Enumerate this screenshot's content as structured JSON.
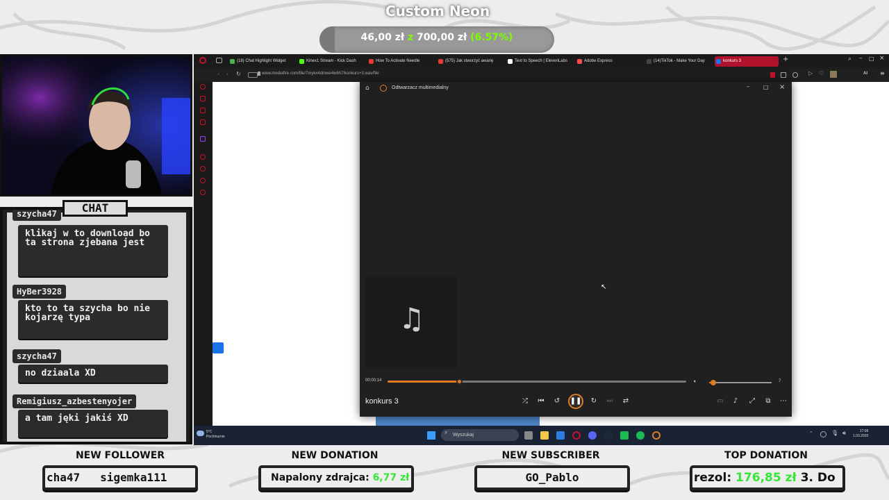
{
  "goal": {
    "title": "Custom Neon",
    "current": "46,00 zł",
    "separator": "z",
    "target": "700,00 zł",
    "percent": "(6.57%)",
    "progress": 0.0657
  },
  "chat": {
    "title": "CHAT",
    "messages": [
      {
        "user": "szycha47",
        "text": "klikaj w to download bo ta strona zjebana jest"
      },
      {
        "user": "HyBer3928",
        "text": "kto to ta szycha bo nie kojarzę typa"
      },
      {
        "user": "szycha47",
        "text": "no dziaala XD"
      },
      {
        "user": "Remigiusz_azbestenyojer",
        "text": "a tam jęki jakiś XD"
      }
    ]
  },
  "browser": {
    "tabs": [
      {
        "label": "(18) Chat Highlight Widget",
        "color": "#4caf50"
      },
      {
        "label": "Kinex1 Stream - Kick Dash",
        "color": "#53fc18"
      },
      {
        "label": "How To Activate Needle",
        "color": "#e53935"
      },
      {
        "label": "(575) Jak stworzyć awarię",
        "color": "#e53935"
      },
      {
        "label": "Text to Speech | ElevenLabs",
        "color": "#ffffff"
      },
      {
        "label": "Adobe Express",
        "color": "#ff4c4c"
      },
      {
        "label": "(14)TikTok - Make Your Day",
        "color": "#111111"
      },
      {
        "label": "konkurs 3",
        "color": "#1a73e8"
      }
    ],
    "url": "www.mediafire.com/file/7mykx4dmwe4w6h7/konkurs+3.wav/file"
  },
  "player": {
    "window_title": "Odtwarzacz multimedialny",
    "time_elapsed": "00:00:14",
    "progress": 0.24,
    "volume": 7,
    "volume_fraction": 0.07,
    "track": "konkurs 3",
    "icons": [
      "shuffle-icon",
      "previous-icon",
      "rewind-10-icon",
      "pause-icon",
      "forward-30-icon",
      "next-icon",
      "repeat-off-icon"
    ]
  },
  "taskbar": {
    "temperature": "5°C",
    "weather": "Pochmurnie",
    "search_placeholder": "Wyszukaj",
    "time": "17:08",
    "date": "1.03.2026"
  },
  "alerts": {
    "follower": {
      "label": "NEW FOLLOWER",
      "value": "cha47   sigemka111"
    },
    "donation": {
      "label": "NEW DONATION",
      "name": "Napalony zdrajca:",
      "amount": "6,77 zł"
    },
    "subscriber": {
      "label": "NEW SUBSCRIBER",
      "value": "GO_Pablo"
    },
    "top_donation": {
      "label": "TOP DONATION",
      "name": "rezol:",
      "amount": "176,85 zł",
      "rank": "3. Do"
    }
  },
  "colors": {
    "accent": "#e07b24",
    "goal_green": "#7cfc00",
    "opera_red": "#c8102e"
  }
}
